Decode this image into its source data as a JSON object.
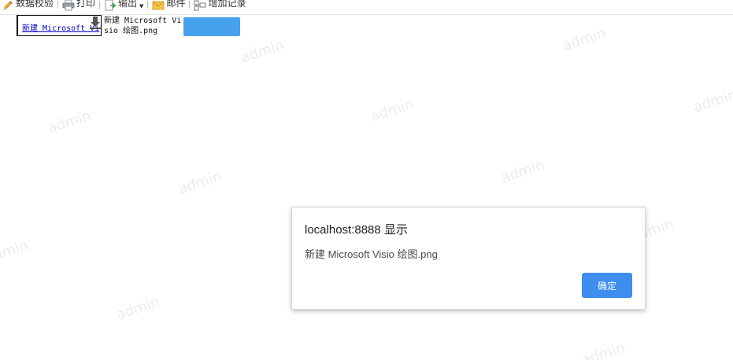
{
  "toolbar": {
    "items": [
      {
        "label": "数据校验",
        "icon": "pencil-icon"
      },
      {
        "label": "打印",
        "icon": "printer-icon"
      },
      {
        "label": "输出",
        "icon": "export-icon",
        "has_dropdown": true
      },
      {
        "label": "邮件",
        "icon": "mail-icon"
      },
      {
        "label": "增加记录",
        "icon": "add-record-icon"
      }
    ]
  },
  "attachment": {
    "link_text": "新建 Microsoft Vi",
    "file_name": "新建 Microsoft Visio 绘图.png",
    "download_icon": "download-icon"
  },
  "upload_button": {
    "label": "",
    "color": "#46a2ec"
  },
  "watermark": {
    "text": "admin"
  },
  "dialog": {
    "title": "localhost:8888 显示",
    "message": "新建 Microsoft Visio 绘图.png",
    "ok_label": "确定",
    "ok_color": "#3e8ef0"
  }
}
